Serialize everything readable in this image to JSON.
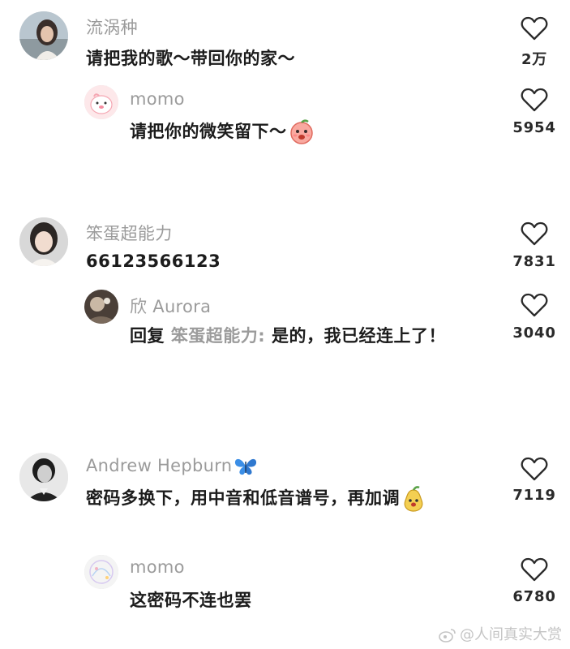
{
  "comments": [
    {
      "username": "流涡种",
      "text": "请把我的歌～带回你的家～",
      "likes": "2万",
      "reply": {
        "username": "momo",
        "text": "请把你的微笑留下～",
        "likes": "5954"
      }
    },
    {
      "username": "笨蛋超能力",
      "text": "66123566123",
      "likes": "7831",
      "reply": {
        "username": "欣 Aurora",
        "reply_prefix": "回复",
        "mention": "笨蛋超能力:",
        "text": "是的，我已经连上了！",
        "likes": "3040"
      }
    },
    {
      "username": "Andrew Hepburn",
      "text": "密码多换下，用中音和低音谱号，再加调",
      "likes": "7119",
      "reply": {
        "username": "momo",
        "text": "这密码不连也罢",
        "likes": "6780"
      }
    }
  ],
  "watermark": "@人间真实大赏",
  "icons": {
    "like": "heart-outline-icon",
    "emoji_peach": "peach-face-emoji",
    "emoji_butterfly": "blue-butterfly-icon",
    "emoji_pear": "pear-face-emoji",
    "weibo": "weibo-logo-icon"
  },
  "colors": {
    "username": "#9b9b9b",
    "body": "#1c1c1c",
    "butterfly": "#3b8ee6"
  }
}
